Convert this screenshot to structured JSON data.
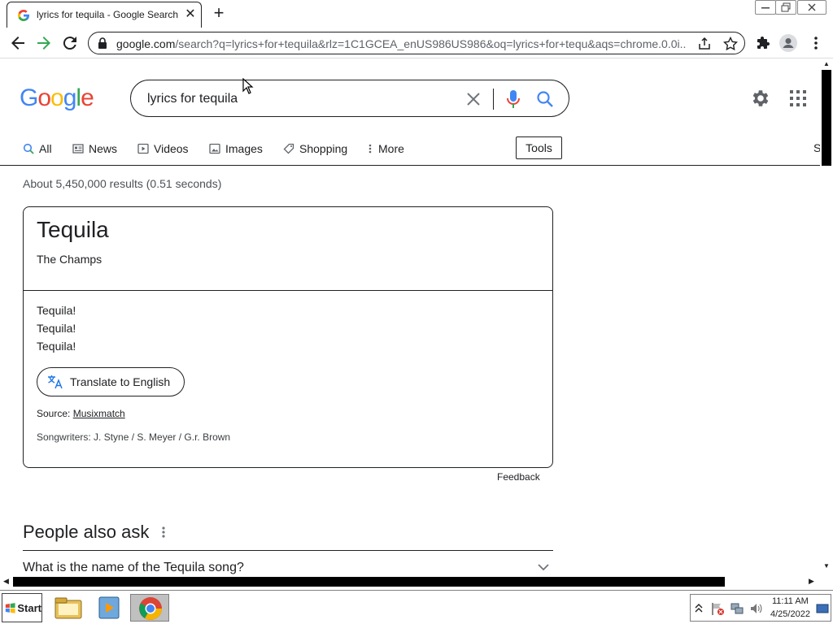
{
  "browser": {
    "tab_title": "lyrics for tequila - Google Search",
    "new_tab_label": "+",
    "url_host": "google.com",
    "url_rest": "/search?q=lyrics+for+tequila&rlz=1C1GCEA_enUS986US986&oq=lyrics+for+tequ&aqs=chrome.0.0i..."
  },
  "google": {
    "logo_letters": [
      "G",
      "o",
      "o",
      "g",
      "l",
      "e"
    ],
    "logo_colors": [
      "#4285F4",
      "#EA4335",
      "#FBBC05",
      "#4285F4",
      "#34A853",
      "#EA4335"
    ],
    "query": "lyrics for tequila",
    "tabs": [
      {
        "label": "All",
        "icon": "search-icon"
      },
      {
        "label": "News",
        "icon": "news-icon"
      },
      {
        "label": "Videos",
        "icon": "video-icon"
      },
      {
        "label": "Images",
        "icon": "image-icon"
      },
      {
        "label": "Shopping",
        "icon": "tag-icon"
      },
      {
        "label": "More",
        "icon": "more-vert-icon"
      }
    ],
    "tools_label": "Tools",
    "cut_label": "S",
    "stats": "About 5,450,000 results (0.51 seconds)"
  },
  "lyrics_card": {
    "song": "Tequila",
    "artist": "The Champs",
    "lines": [
      "Tequila!",
      "Tequila!",
      "Tequila!"
    ],
    "translate_label": "Translate to English",
    "source_prefix": "Source: ",
    "source_link": "Musixmatch",
    "songwriters": "Songwriters: J. Styne / S. Meyer / G.r. Brown"
  },
  "feedback_label": "Feedback",
  "people_also_ask": {
    "title": "People also ask",
    "questions": [
      "What is the name of the Tequila song?"
    ]
  },
  "taskbar": {
    "start_label": "Start",
    "time": "11:11 AM",
    "date": "4/25/2022"
  },
  "colors": {
    "blue": "#1a73e8",
    "google_blue": "#4285F4",
    "google_red": "#EA4335",
    "google_yellow": "#FBBC05",
    "google_green": "#34A853"
  }
}
